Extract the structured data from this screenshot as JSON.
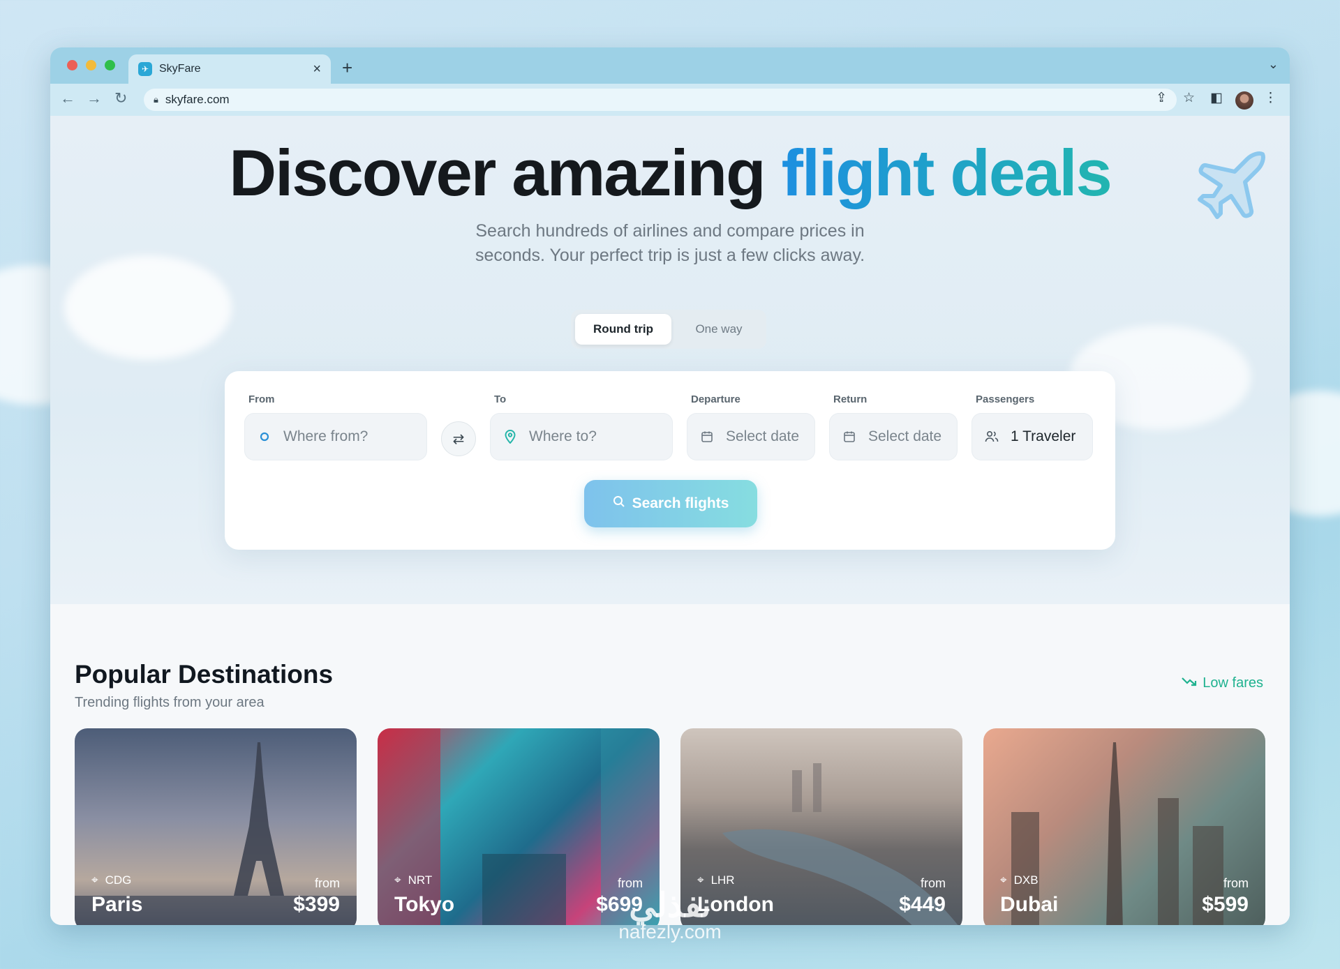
{
  "browser": {
    "tab_title": "SkyFare",
    "url": "skyfare.com",
    "new_tab_label": "+",
    "tab_close_label": "×"
  },
  "hero": {
    "title_plain": "Discover amazing ",
    "title_accent": "flight deals",
    "subtitle": "Search hundreds of airlines and compare prices in seconds. Your perfect trip is just a few clicks away."
  },
  "trip_toggle": {
    "round_trip": "Round trip",
    "one_way": "One way",
    "selected": "Round trip"
  },
  "search_form": {
    "from_label": "From",
    "from_placeholder": "Where from?",
    "to_label": "To",
    "to_placeholder": "Where to?",
    "departure_label": "Departure",
    "departure_placeholder": "Select date",
    "return_label": "Return",
    "return_placeholder": "Select date",
    "passengers_label": "Passengers",
    "passengers_value": "1 Traveler",
    "search_button": "Search flights"
  },
  "popular": {
    "title": "Popular Destinations",
    "subtitle": "Trending flights from your area",
    "low_fares": "Low fares",
    "destinations": [
      {
        "code": "CDG",
        "city": "Paris",
        "from": "from",
        "price": "$399"
      },
      {
        "code": "NRT",
        "city": "Tokyo",
        "from": "from",
        "price": "$699"
      },
      {
        "code": "LHR",
        "city": "London",
        "from": "from",
        "price": "$449"
      },
      {
        "code": "DXB",
        "city": "Dubai",
        "from": "from",
        "price": "$599"
      }
    ]
  },
  "watermark": {
    "arabic": "نفذلي",
    "latin": "nafezly.com"
  },
  "colors": {
    "accent_blue": "#1d8fe0",
    "accent_teal": "#22b5b0",
    "low_fares_green": "#1fb28f",
    "search_button_start": "#7ec2ec",
    "search_button_end": "#86dde0"
  },
  "icons": [
    "search-icon",
    "swap-icon",
    "location-pin-icon",
    "calendar-icon",
    "users-icon",
    "trending-down-icon",
    "plane-icon",
    "lock-icon",
    "share-icon",
    "star-icon",
    "sidebar-icon",
    "more-icon"
  ]
}
